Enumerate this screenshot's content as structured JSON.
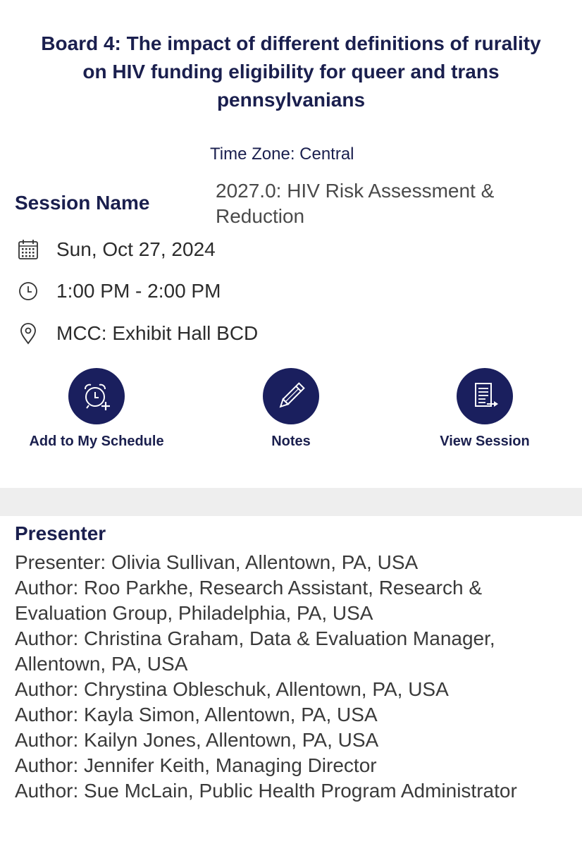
{
  "title": "Board 4: The impact of different definitions of rurality on HIV funding eligibility for queer and trans pennsylvanians",
  "timezone": "Time Zone: Central",
  "session": {
    "label": "Session Name",
    "value": "2027.0: HIV Risk Assessment & Reduction"
  },
  "details": {
    "date": "Sun, Oct 27, 2024",
    "time": "1:00 PM - 2:00 PM",
    "location": "MCC: Exhibit Hall BCD"
  },
  "actions": {
    "schedule": "Add to My Schedule",
    "notes": "Notes",
    "view_session": "View Session"
  },
  "colors": {
    "accent": "#1a1f5e",
    "heading": "#1a1f4e",
    "divider": "#eeeeee"
  },
  "presenter": {
    "heading": "Presenter",
    "entries": [
      "Presenter:  Olivia Sullivan, Allentown, PA, USA",
      "Author:  Roo Parkhe, Research Assistant, Research & Evaluation Group, Philadelphia, PA, USA",
      "Author:  Christina Graham, Data & Evaluation Manager, Allentown, PA, USA",
      "Author:  Chrystina Obleschuk, Allentown, PA, USA",
      "Author:  Kayla Simon, Allentown, PA, USA",
      "Author:  Kailyn Jones, Allentown, PA, USA",
      "Author:  Jennifer Keith, Managing Director",
      "Author:  Sue McLain, Public Health Program Administrator"
    ]
  }
}
